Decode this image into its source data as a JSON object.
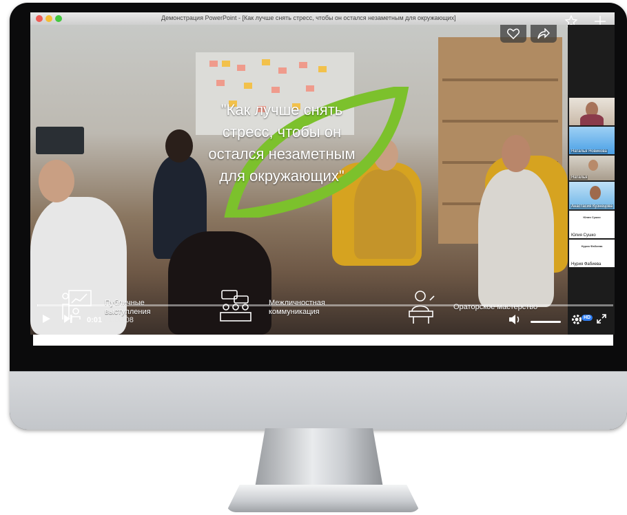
{
  "window": {
    "title": "Демонстрация PowerPoint - [Как лучше снять стресс, чтобы он остался незаметным для окружающих]"
  },
  "slide": {
    "quote": "\"Как лучше снять стресс, чтобы он остался незаметным для окружающих\"",
    "accent_color": "#7cc12c",
    "topics": [
      {
        "icon": "presentation-icon",
        "label": "Публичные выступления"
      },
      {
        "icon": "meeting-icon",
        "label": "Межличностная коммуникация"
      },
      {
        "icon": "speaker-podium-icon",
        "label": "Ораторское мастерство"
      }
    ]
  },
  "player": {
    "current_time": "0:01",
    "duration": "1:00:08",
    "separator": " / ",
    "progress_fraction": 0.0003,
    "hd_badge": "HD",
    "overlay_buttons": [
      "heart-icon",
      "share-icon",
      "star-icon",
      "plus-icon"
    ]
  },
  "participants": [
    {
      "name": "",
      "kind": "camera"
    },
    {
      "name": "Наталья Новикова",
      "kind": "camera"
    },
    {
      "name": "Наталья",
      "kind": "camera"
    },
    {
      "name": "Анастасия Кузнецова",
      "kind": "camera"
    },
    {
      "name": "Юлия Сушко",
      "heading": "Юлия Сушко",
      "kind": "placeholder"
    },
    {
      "name": "Нурия Фабиева",
      "heading": "Нурия Фабиева",
      "kind": "placeholder"
    }
  ]
}
